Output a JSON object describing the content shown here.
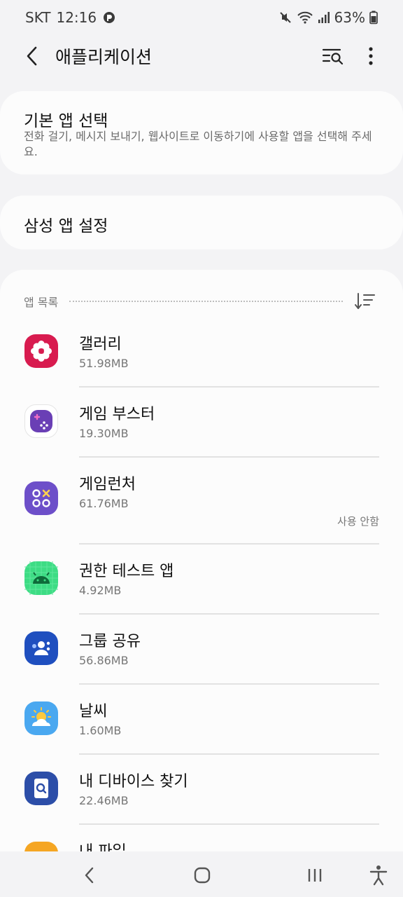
{
  "status_bar": {
    "carrier": "SKT",
    "time": "12:16",
    "battery": "63%",
    "icons": [
      "app-notification-icon",
      "mute-icon",
      "wifi-icon",
      "signal-icon",
      "battery-icon"
    ]
  },
  "header": {
    "title": "애플리케이션",
    "icons": [
      "back-arrow-icon",
      "search-list-icon",
      "more-options-icon"
    ]
  },
  "default_apps": {
    "title": "기본 앱 선택",
    "description": "전화 걸기, 메시지 보내기, 웹사이트로 이동하기에 사용할 앱을 선택해 주세요."
  },
  "samsung_settings": {
    "title": "삼성 앱 설정"
  },
  "app_list": {
    "header": "앱 목록",
    "apps": [
      {
        "name": "갤러리",
        "size": "51.98MB",
        "status": "",
        "icon": "gallery-icon",
        "color": "#d81b4f"
      },
      {
        "name": "게임 부스터",
        "size": "19.30MB",
        "status": "",
        "icon": "game-booster-icon",
        "color": "#6a3fb5"
      },
      {
        "name": "게임런처",
        "size": "61.76MB",
        "status": "사용 안함",
        "icon": "game-launcher-icon",
        "color": "#6d4fc9"
      },
      {
        "name": "권한 테스트 앱",
        "size": "4.92MB",
        "status": "",
        "icon": "android-icon",
        "color": "#3ddc84"
      },
      {
        "name": "그룹 공유",
        "size": "56.86MB",
        "status": "",
        "icon": "group-share-icon",
        "color": "#1f4fbf"
      },
      {
        "name": "날씨",
        "size": "1.60MB",
        "status": "",
        "icon": "weather-icon",
        "color": "#4aa8f0"
      },
      {
        "name": "내 디바이스 찾기",
        "size": "22.46MB",
        "status": "",
        "icon": "find-my-device-icon",
        "color": "#2c4ea8"
      },
      {
        "name": "내 파일",
        "size": "",
        "status": "",
        "icon": "my-files-icon",
        "color": "#f5a623"
      }
    ]
  },
  "nav_bar": {
    "icons": [
      "nav-back-icon",
      "nav-home-icon",
      "nav-recents-icon",
      "accessibility-icon"
    ]
  }
}
